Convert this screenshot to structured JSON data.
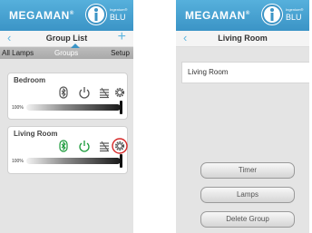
{
  "brand": {
    "name": "MEGAMAN",
    "reg": "®",
    "sub1": "Ingenium®",
    "sub2": "BLU"
  },
  "left": {
    "nav_title": "Group List",
    "back_icon": "‹",
    "plus_icon": "+",
    "tabs": [
      "All Lamps",
      "Groups",
      "Setup"
    ],
    "groups": [
      {
        "name": "Bedroom",
        "brightness": "100%",
        "level": 1.0,
        "bluetooth_color": "#555555",
        "power_color": "#555555",
        "settings_highlighted": false
      },
      {
        "name": "Living Room",
        "brightness": "100%",
        "level": 1.0,
        "bluetooth_color": "#1a9a3a",
        "power_color": "#1a9a3a",
        "settings_highlighted": true
      }
    ]
  },
  "right": {
    "nav_title": "Living Room",
    "back_icon": "‹",
    "group_name": "Living Room",
    "buttons": [
      "Timer",
      "Lamps",
      "Delete Group"
    ]
  },
  "colors": {
    "header": "#3b94c6",
    "accent": "#5fb6e0",
    "active_green": "#1a9a3a",
    "highlight_ring": "#d62828"
  },
  "icons": [
    "bluetooth-icon",
    "power-icon",
    "sliders-icon",
    "gear-icon",
    "back-chevron-icon",
    "plus-icon"
  ]
}
